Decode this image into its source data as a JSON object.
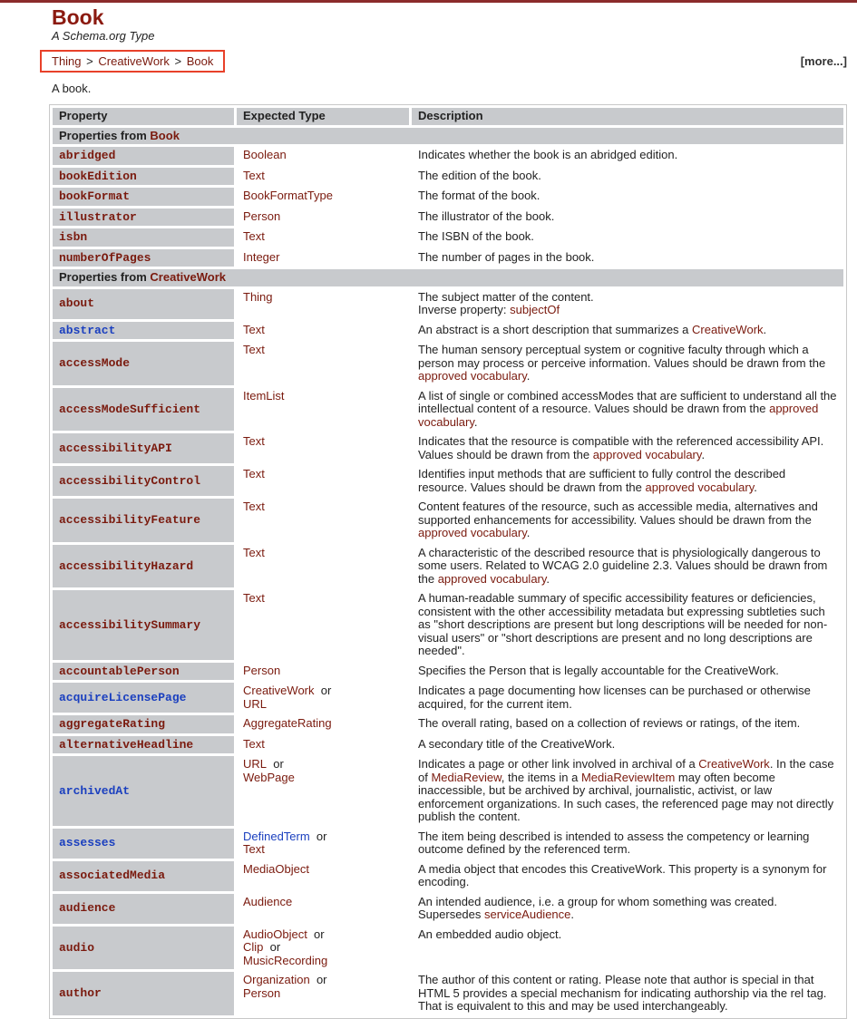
{
  "page": {
    "title": "Book",
    "subtitle": "A Schema.org Type",
    "breadcrumb": [
      "Thing",
      "CreativeWork",
      "Book"
    ],
    "breadcrumb_separator": ">",
    "more_link": "[more...]",
    "intro": "A book.",
    "accent_color": "#8b1a10",
    "highlight_box_color": "#e8412a"
  },
  "table": {
    "headers": [
      "Property",
      "Expected Type",
      "Description"
    ],
    "groups": [
      {
        "label_prefix": "Properties from ",
        "label_type": "Book",
        "rows": [
          {
            "property": "abridged",
            "pending": false,
            "types": [
              "Boolean"
            ],
            "desc": [
              {
                "t": "Indicates whether the book is an abridged edition."
              }
            ]
          },
          {
            "property": "bookEdition",
            "pending": false,
            "types": [
              "Text"
            ],
            "desc": [
              {
                "t": "The edition of the book."
              }
            ]
          },
          {
            "property": "bookFormat",
            "pending": false,
            "types": [
              "BookFormatType"
            ],
            "desc": [
              {
                "t": "The format of the book."
              }
            ]
          },
          {
            "property": "illustrator",
            "pending": false,
            "types": [
              "Person"
            ],
            "desc": [
              {
                "t": "The illustrator of the book."
              }
            ]
          },
          {
            "property": "isbn",
            "pending": false,
            "types": [
              "Text"
            ],
            "desc": [
              {
                "t": "The ISBN of the book."
              }
            ]
          },
          {
            "property": "numberOfPages",
            "pending": false,
            "types": [
              "Integer"
            ],
            "desc": [
              {
                "t": "The number of pages in the book."
              }
            ]
          }
        ]
      },
      {
        "label_prefix": "Properties from ",
        "label_type": "CreativeWork",
        "rows": [
          {
            "property": "about",
            "pending": false,
            "types": [
              "Thing"
            ],
            "desc": [
              {
                "t": "The subject matter of the content."
              },
              {
                "br": true
              },
              {
                "t": "Inverse property: "
              },
              {
                "link": "subjectOf"
              }
            ]
          },
          {
            "property": "abstract",
            "pending": true,
            "types": [
              "Text"
            ],
            "desc": [
              {
                "t": "An abstract is a short description that summarizes a "
              },
              {
                "link": "CreativeWork"
              },
              {
                "t": "."
              }
            ]
          },
          {
            "property": "accessMode",
            "pending": false,
            "types": [
              "Text"
            ],
            "desc": [
              {
                "t": "The human sensory perceptual system or cognitive faculty through which a person may process or perceive information. Values should be drawn from the "
              },
              {
                "link": "approved vocabulary"
              },
              {
                "t": "."
              }
            ]
          },
          {
            "property": "accessModeSufficient",
            "pending": false,
            "types": [
              "ItemList"
            ],
            "desc": [
              {
                "t": "A list of single or combined accessModes that are sufficient to understand all the intellectual content of a resource. Values should be drawn from the "
              },
              {
                "link": "approved vocabulary"
              },
              {
                "t": "."
              }
            ]
          },
          {
            "property": "accessibilityAPI",
            "pending": false,
            "types": [
              "Text"
            ],
            "desc": [
              {
                "t": "Indicates that the resource is compatible with the referenced accessibility API. Values should be drawn from the "
              },
              {
                "link": "approved vocabulary"
              },
              {
                "t": "."
              }
            ]
          },
          {
            "property": "accessibilityControl",
            "pending": false,
            "types": [
              "Text"
            ],
            "desc": [
              {
                "t": "Identifies input methods that are sufficient to fully control the described resource. Values should be drawn from the "
              },
              {
                "link": "approved vocabulary"
              },
              {
                "t": "."
              }
            ]
          },
          {
            "property": "accessibilityFeature",
            "pending": false,
            "types": [
              "Text"
            ],
            "desc": [
              {
                "t": "Content features of the resource, such as accessible media, alternatives and supported enhancements for accessibility. Values should be drawn from the "
              },
              {
                "link": "approved vocabulary"
              },
              {
                "t": "."
              }
            ]
          },
          {
            "property": "accessibilityHazard",
            "pending": false,
            "types": [
              "Text"
            ],
            "desc": [
              {
                "t": "A characteristic of the described resource that is physiologically dangerous to some users. Related to WCAG 2.0 guideline 2.3. Values should be drawn from the "
              },
              {
                "link": "approved vocabulary"
              },
              {
                "t": "."
              }
            ]
          },
          {
            "property": "accessibilitySummary",
            "pending": false,
            "types": [
              "Text"
            ],
            "desc": [
              {
                "t": "A human-readable summary of specific accessibility features or deficiencies, consistent with the other accessibility metadata but expressing subtleties such as \"short descriptions are present but long descriptions will be needed for non-visual users\" or \"short descriptions are present and no long descriptions are needed\"."
              }
            ]
          },
          {
            "property": "accountablePerson",
            "pending": false,
            "types": [
              "Person"
            ],
            "desc": [
              {
                "t": "Specifies the Person that is legally accountable for the CreativeWork."
              }
            ]
          },
          {
            "property": "acquireLicensePage",
            "pending": true,
            "types": [
              "CreativeWork",
              "URL"
            ],
            "desc": [
              {
                "t": "Indicates a page documenting how licenses can be purchased or otherwise acquired, for the current item."
              }
            ]
          },
          {
            "property": "aggregateRating",
            "pending": false,
            "types": [
              "AggregateRating"
            ],
            "desc": [
              {
                "t": "The overall rating, based on a collection of reviews or ratings, of the item."
              }
            ]
          },
          {
            "property": "alternativeHeadline",
            "pending": false,
            "types": [
              "Text"
            ],
            "desc": [
              {
                "t": "A secondary title of the CreativeWork."
              }
            ]
          },
          {
            "property": "archivedAt",
            "pending": true,
            "types": [
              "URL",
              "WebPage"
            ],
            "desc": [
              {
                "t": "Indicates a page or other link involved in archival of a "
              },
              {
                "link": "CreativeWork"
              },
              {
                "t": ". In the case of "
              },
              {
                "link": "MediaReview"
              },
              {
                "t": ", the items in a "
              },
              {
                "link": "MediaReviewItem"
              },
              {
                "t": " may often become inaccessible, but be archived by archival, journalistic, activist, or law enforcement organizations. In such cases, the referenced page may not directly publish the content."
              }
            ]
          },
          {
            "property": "assesses",
            "pending": true,
            "types": [
              "DefinedTerm",
              "Text"
            ],
            "pending_types": [
              "DefinedTerm"
            ],
            "desc": [
              {
                "t": "The item being described is intended to assess the competency or learning outcome defined by the referenced term."
              }
            ]
          },
          {
            "property": "associatedMedia",
            "pending": false,
            "types": [
              "MediaObject"
            ],
            "desc": [
              {
                "t": "A media object that encodes this CreativeWork. This property is a synonym for encoding."
              }
            ]
          },
          {
            "property": "audience",
            "pending": false,
            "types": [
              "Audience"
            ],
            "desc": [
              {
                "t": "An intended audience, i.e. a group for whom something was created. Supersedes "
              },
              {
                "link": "serviceAudience"
              },
              {
                "t": "."
              }
            ]
          },
          {
            "property": "audio",
            "pending": false,
            "types": [
              "AudioObject",
              "Clip",
              "MusicRecording"
            ],
            "desc": [
              {
                "t": "An embedded audio object."
              }
            ]
          },
          {
            "property": "author",
            "pending": false,
            "types": [
              "Organization",
              "Person"
            ],
            "desc": [
              {
                "t": "The author of this content or rating. Please note that author is special in that HTML 5 provides a special mechanism for indicating authorship via the rel tag. That is equivalent to this and may be used interchangeably."
              }
            ]
          }
        ]
      }
    ],
    "or_word": "or"
  }
}
